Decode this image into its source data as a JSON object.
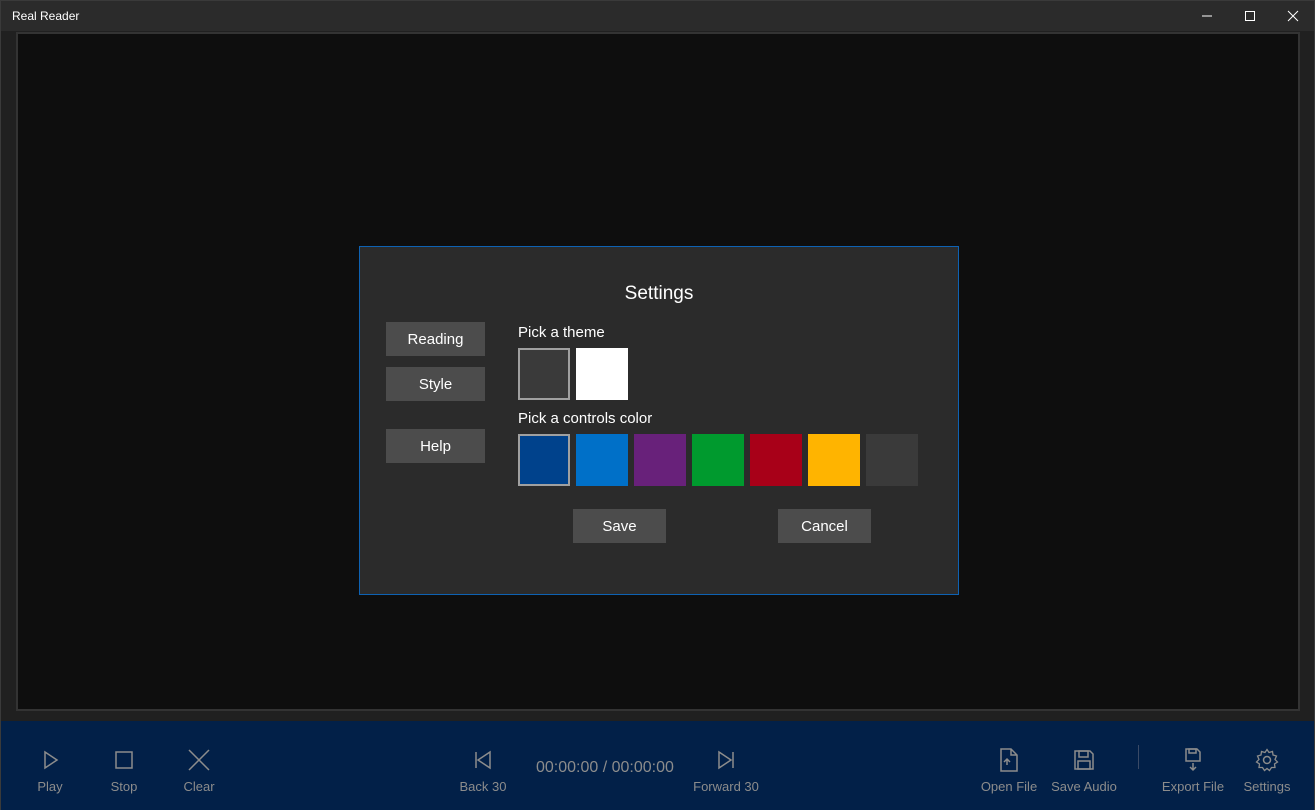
{
  "window": {
    "title": "Real Reader"
  },
  "dialog": {
    "title": "Settings",
    "nav": {
      "reading": "Reading",
      "style": "Style",
      "help": "Help"
    },
    "theme_label": "Pick a theme",
    "themes": [
      {
        "name": "dark",
        "color": "#3a3a3a",
        "selected": true
      },
      {
        "name": "light",
        "color": "#ffffff",
        "selected": false
      }
    ],
    "controls_label": "Pick a controls color",
    "control_colors": [
      {
        "color": "#00428c",
        "selected": true
      },
      {
        "color": "#0070c8",
        "selected": false
      },
      {
        "color": "#68217a",
        "selected": false
      },
      {
        "color": "#009a2e",
        "selected": false
      },
      {
        "color": "#a80018",
        "selected": false
      },
      {
        "color": "#ffb400",
        "selected": false
      },
      {
        "color": "#3a3a3a",
        "selected": false
      }
    ],
    "save": "Save",
    "cancel": "Cancel"
  },
  "toolbar": {
    "play": "Play",
    "stop": "Stop",
    "clear": "Clear",
    "back": "Back 30",
    "time": "00:00:00 / 00:00:00",
    "forward": "Forward 30",
    "open_file": "Open File",
    "save_audio": "Save Audio",
    "export_file": "Export File",
    "settings": "Settings"
  },
  "colors": {
    "accent": "#0e62b3",
    "toolbar_bg": "#022048",
    "icon": "#8c8c8c"
  }
}
